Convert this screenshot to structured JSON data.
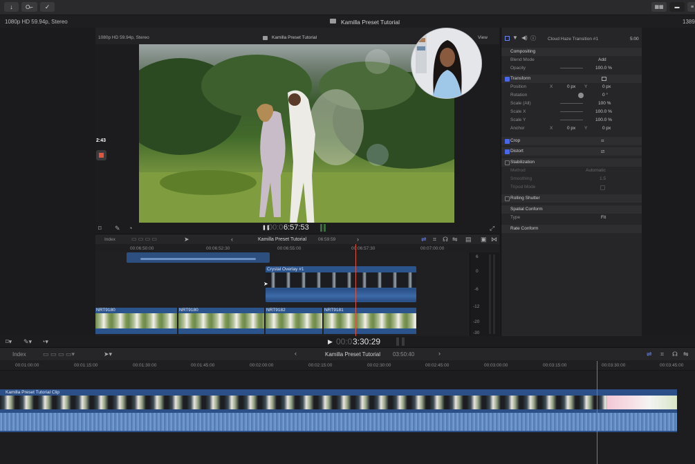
{
  "outer": {
    "format": "1080p HD 59.94p, Stereo",
    "project": "Kamilla Preset Tutorial",
    "right_clip": "1389"
  },
  "inner": {
    "format": "1080p HD 59.94p, Stereo",
    "project": "Kamilla Preset Tutorial",
    "view_label": "View",
    "recording_time": "2:43"
  },
  "inspector": {
    "title": "Cloud Haze Transition #1",
    "time": "5:00",
    "compositing": "Compositing",
    "blend_mode_label": "Blend Mode",
    "blend_mode_value": "Add",
    "opacity_label": "Opacity",
    "opacity_value": "100.0 %",
    "transform": "Transform",
    "position_label": "Position",
    "position_x": "0 px",
    "position_y": "0 px",
    "rotation_label": "Rotation",
    "rotation_value": "0 °",
    "scale_all_label": "Scale (All)",
    "scale_all_value": "100 %",
    "scale_x_label": "Scale X",
    "scale_x_value": "100.0 %",
    "scale_y_label": "Scale Y",
    "scale_y_value": "100.0 %",
    "anchor_label": "Anchor",
    "anchor_x": "0 px",
    "anchor_y": "0 px",
    "x_label": "X",
    "y_label": "Y",
    "crop": "Crop",
    "distort": "Distort",
    "stabilization": "Stabilization",
    "method_label": "Method",
    "method_value": "Automatic",
    "smoothing_label": "Smoothing",
    "smoothing_value": "1.5",
    "tripod_label": "Tripod Mode",
    "rolling_shutter": "Rolling Shutter",
    "spatial_conform": "Spatial Conform",
    "type_label": "Type",
    "type_value": "Fit",
    "rate_conform": "Rate Conform"
  },
  "inner_viewer": {
    "timecode": "6:57:53",
    "timecode_prefix": "00:0"
  },
  "inner_timeline": {
    "index_label": "Index",
    "project": "Kamilla Preset Tutorial",
    "duration": "06:59:59",
    "ruler": [
      "00:06:50:00",
      "00:06:52:30",
      "00:06:55:00",
      "00:06:57:30",
      "00:07:00:00"
    ],
    "overlay_clip": "Crystal Overlay #1",
    "clips": [
      "NRT9180",
      "NRT9180",
      "NRT9182",
      "NRT9181"
    ],
    "meter_labels": [
      "6",
      "0",
      "-6",
      "-12",
      "-20",
      "-30"
    ]
  },
  "outer_viewer": {
    "timecode": "3:30:29",
    "timecode_prefix": "00:0"
  },
  "outer_timeline": {
    "index_label": "Index",
    "project": "Kamilla Preset Tutorial",
    "duration": "03:50:40",
    "ruler": [
      "00:01:00:00",
      "00:01:15:00",
      "00:01:30:00",
      "00:01:45:00",
      "00:02:00:00",
      "00:02:15:00",
      "00:02:30:00",
      "00:02:45:00",
      "00:03:00:00",
      "00:03:15:00",
      "00:03:30:00",
      "00:03:45:00"
    ],
    "clip_name": "Kamilla Preset Tutorial Clip"
  },
  "colors": {
    "accent_blue": "#4a67e8",
    "playhead": "#e0553b",
    "clip_blue": "#2f5c96",
    "record_red": "#e0553b"
  }
}
